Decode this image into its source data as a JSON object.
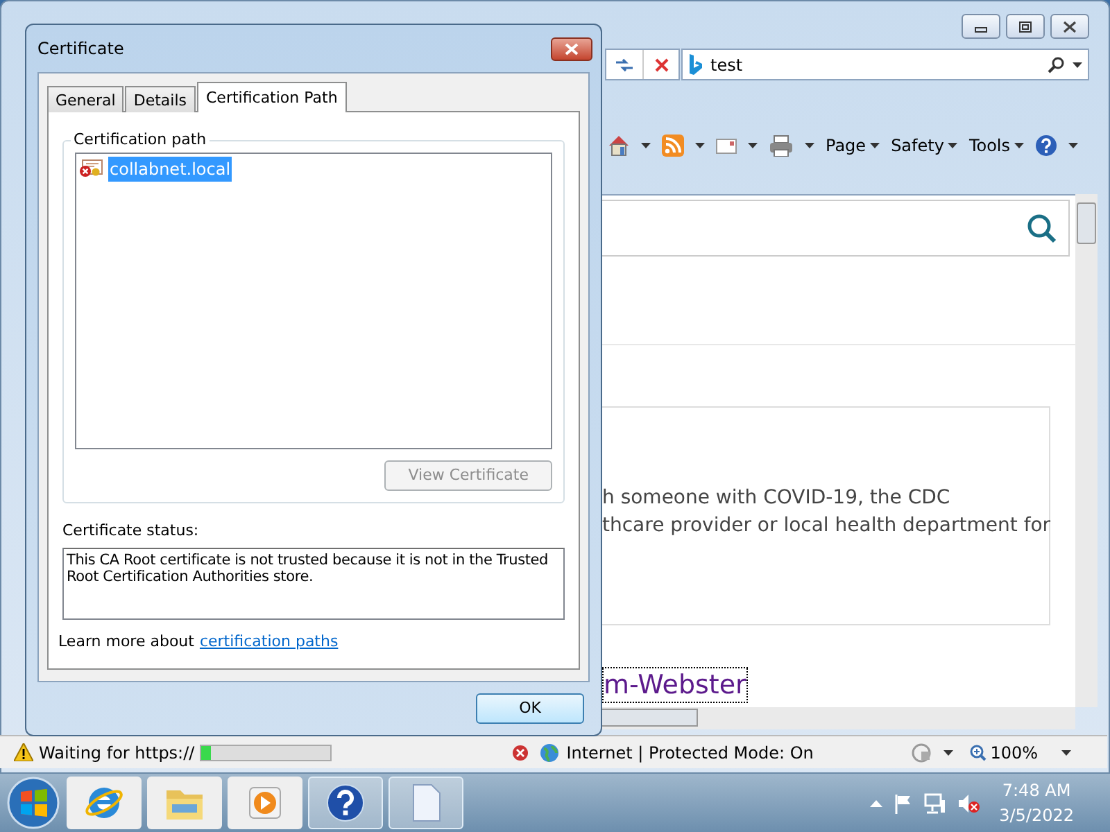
{
  "browser": {
    "search_box": {
      "value": "test"
    },
    "command_bar": [
      {
        "kind": "home"
      },
      {
        "kind": "feeds"
      },
      {
        "kind": "mail"
      },
      {
        "kind": "print"
      },
      {
        "kind": "menu",
        "label": "Page"
      },
      {
        "kind": "menu",
        "label": "Safety"
      },
      {
        "kind": "menu",
        "label": "Tools"
      },
      {
        "kind": "help"
      }
    ],
    "content": {
      "paragraph_lines": [
        "h someone with COVID-19, the CDC",
        "thcare provider or local health department for"
      ],
      "link": "m-Webster"
    },
    "status_bar": {
      "text": "Waiting for https://",
      "progress": {
        "level": 0.07
      },
      "zone": "Internet | Protected Mode: On",
      "zoom": "100%"
    }
  },
  "dialog": {
    "title": "Certificate",
    "tabs": [
      {
        "label": "General",
        "selected": false
      },
      {
        "label": "Details",
        "selected": false
      },
      {
        "label": "Certification Path",
        "selected": true
      }
    ],
    "group_label": "Certification path",
    "tree": [
      {
        "label": "collabnet.local",
        "selected": true,
        "error": true
      }
    ],
    "view_button": {
      "label": "View Certificate",
      "disabled": true
    },
    "status_label": "Certificate status:",
    "status_text": "This CA Root certificate is not trusted because it is not in the Trusted Root Certification Authorities store.",
    "learn_more": {
      "text": "Learn more about",
      "link": "certification paths"
    },
    "ok_button": "OK"
  },
  "taskbar": {
    "apps": [
      {
        "kind": "ie",
        "active": false
      },
      {
        "kind": "folder",
        "active": false
      },
      {
        "kind": "media",
        "active": false
      },
      {
        "kind": "help",
        "active": true
      },
      {
        "kind": "document",
        "active": true
      }
    ],
    "time": "7:48 AM",
    "date": "3/5/2022"
  }
}
